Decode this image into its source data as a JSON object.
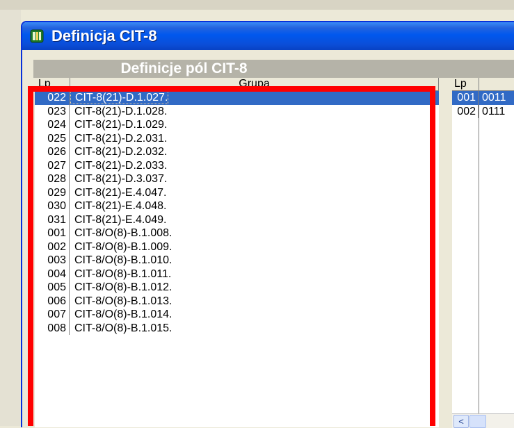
{
  "window": {
    "title": "Definicja CIT-8"
  },
  "section": {
    "header": "Definicje pól CIT-8"
  },
  "left_table": {
    "columns": [
      "Lp",
      "Grupa"
    ],
    "rows": [
      {
        "lp": "022",
        "grupa": "CIT-8(21)-D.1.027.",
        "selected": true
      },
      {
        "lp": "023",
        "grupa": "CIT-8(21)-D.1.028."
      },
      {
        "lp": "024",
        "grupa": "CIT-8(21)-D.1.029."
      },
      {
        "lp": "025",
        "grupa": "CIT-8(21)-D.2.031."
      },
      {
        "lp": "026",
        "grupa": "CIT-8(21)-D.2.032."
      },
      {
        "lp": "027",
        "grupa": "CIT-8(21)-D.2.033."
      },
      {
        "lp": "028",
        "grupa": "CIT-8(21)-D.3.037."
      },
      {
        "lp": "029",
        "grupa": "CIT-8(21)-E.4.047."
      },
      {
        "lp": "030",
        "grupa": "CIT-8(21)-E.4.048."
      },
      {
        "lp": "031",
        "grupa": "CIT-8(21)-E.4.049."
      },
      {
        "lp": "001",
        "grupa": "CIT-8/O(8)-B.1.008."
      },
      {
        "lp": "002",
        "grupa": "CIT-8/O(8)-B.1.009."
      },
      {
        "lp": "003",
        "grupa": "CIT-8/O(8)-B.1.010."
      },
      {
        "lp": "004",
        "grupa": "CIT-8/O(8)-B.1.011."
      },
      {
        "lp": "005",
        "grupa": "CIT-8/O(8)-B.1.012."
      },
      {
        "lp": "006",
        "grupa": "CIT-8/O(8)-B.1.013."
      },
      {
        "lp": "007",
        "grupa": "CIT-8/O(8)-B.1.014."
      },
      {
        "lp": "008",
        "grupa": "CIT-8/O(8)-B.1.015."
      }
    ]
  },
  "right_table": {
    "columns": [
      "Lp",
      ""
    ],
    "rows": [
      {
        "lp": "001",
        "code": "0011"
      },
      {
        "lp": "002",
        "code": "0111"
      }
    ]
  },
  "scrollbar": {
    "left_arrow": "<"
  },
  "colors": {
    "selection": "#316ac5",
    "titlebar": "#0058ee",
    "highlight": "#ff0000"
  }
}
